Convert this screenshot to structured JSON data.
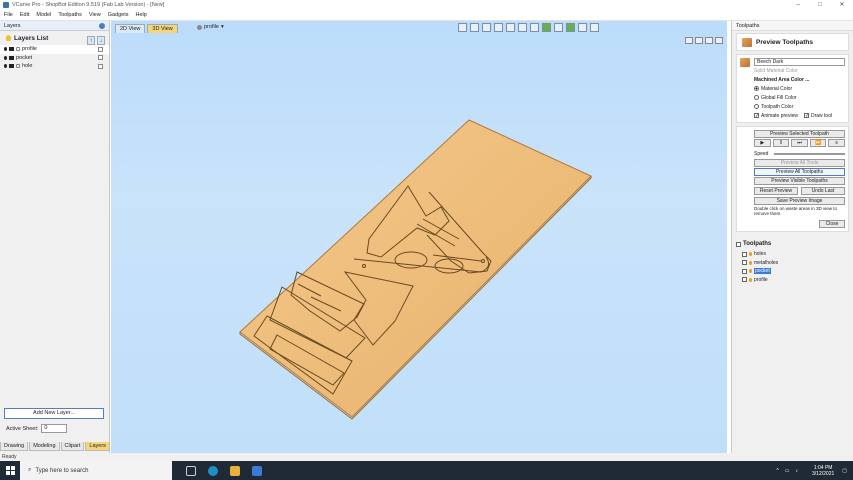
{
  "window": {
    "title": "VCarve Pro - ShopBot Edition 9.519 (Fab Lab Version) - [New]"
  },
  "menu": [
    "File",
    "Edit",
    "Model",
    "Toolpaths",
    "View",
    "Gadgets",
    "Help"
  ],
  "left_panel": {
    "header": "Layers",
    "title": "Layers List",
    "layers": [
      {
        "name": "profile",
        "selected": true
      },
      {
        "name": "pocket",
        "selected": false
      },
      {
        "name": "hole",
        "selected": false
      }
    ],
    "add_button": "Add New Layer...",
    "active_sheet_label": "Active Sheet:",
    "active_sheet_value": "0",
    "bottom_tabs": [
      "Drawing",
      "Modeling",
      "Clipart",
      "Layers"
    ],
    "active_bottom_tab": "Layers"
  },
  "viewport": {
    "tabs": [
      "2D View",
      "3D View"
    ],
    "active_tab": "3D View",
    "layer_selector": "profile"
  },
  "right_panel": {
    "header": "Toolpaths",
    "title": "Preview Toolpaths",
    "material_dropdown": "Beech Dark",
    "solid_color_label": "Solid Material Color",
    "machined_area_label": "Machined Area Color ...",
    "material_color_label": "Material Color",
    "global_fill_label": "Global Fill Color",
    "toolpath_color_label": "Toolpath Color",
    "animate_label": "Animate preview",
    "draw_tool_label": "Draw tool",
    "preview_selected": "Preview Selected Toolpath",
    "speed_label": "Speed",
    "preview_all_tools": "Preview All Tools",
    "preview_all_toolpaths": "Preview All Toolpaths",
    "preview_visible": "Preview Visible Toolpaths",
    "reset_preview": "Reset Preview",
    "undo_last": "Undo Last",
    "save_preview": "Save Preview Image",
    "hint": "Double click on waste areas in 3D view to remove them.",
    "close": "Close",
    "toolpaths_title": "Toolpaths",
    "toolpaths": [
      {
        "name": "holes",
        "selected": false
      },
      {
        "name": "metalholes",
        "selected": false
      },
      {
        "name": "pocket",
        "selected": true
      },
      {
        "name": "profile",
        "selected": false
      }
    ]
  },
  "status": "Ready",
  "taskbar": {
    "search_placeholder": "Type here to search",
    "time": "1:04 PM",
    "date": "3/12/2021"
  }
}
